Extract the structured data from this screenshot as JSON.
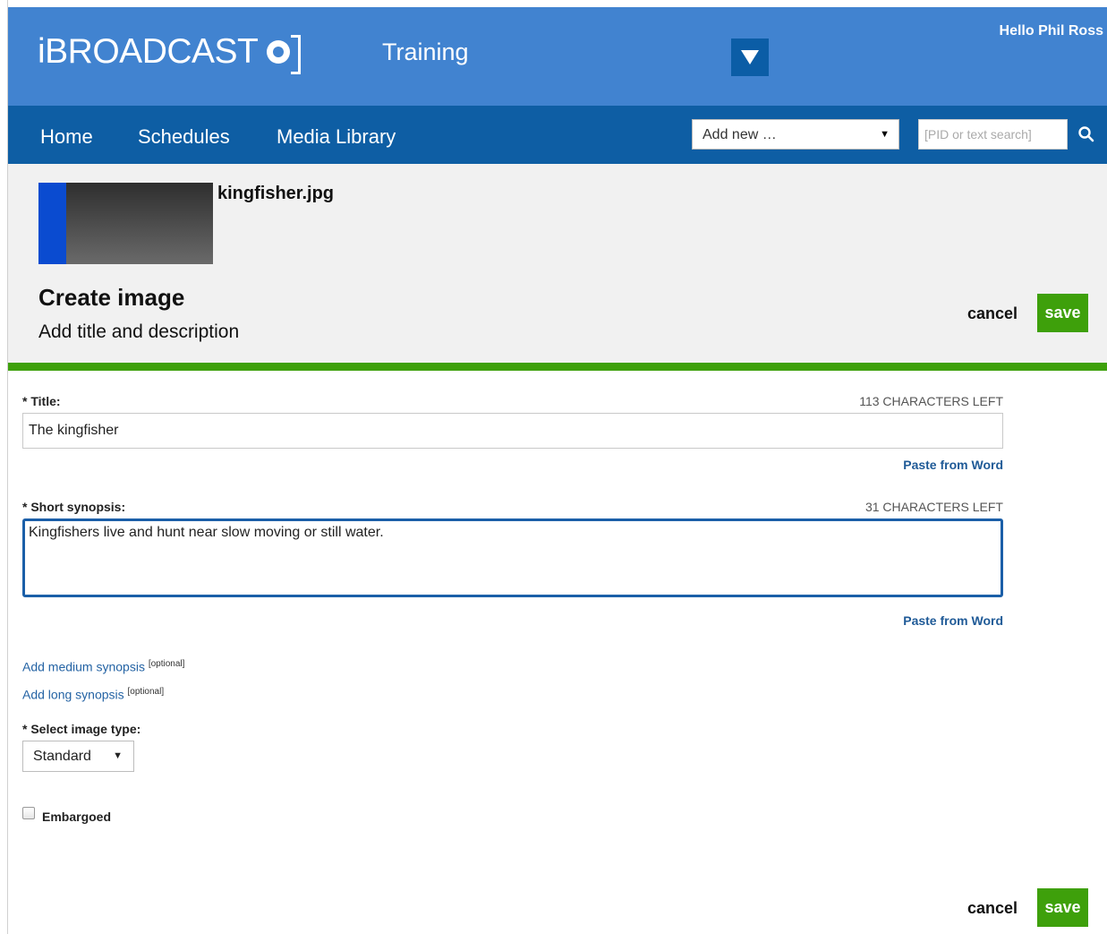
{
  "header": {
    "logo_text": "iBROADCAST",
    "environment": "Training",
    "greeting": "Hello Phil Ross"
  },
  "nav": {
    "items": [
      "Home",
      "Schedules",
      "Media Library"
    ],
    "add_new": "Add new …",
    "search_placeholder": "[PID or text search]"
  },
  "asset": {
    "filename": "kingfisher.jpg",
    "heading": "Create image",
    "subheading": "Add title and description"
  },
  "actions": {
    "cancel": "cancel",
    "save": "save"
  },
  "form": {
    "title": {
      "label": "* Title:",
      "counter": "113 CHARACTERS LEFT",
      "value": "The kingfisher",
      "paste": "Paste from Word"
    },
    "short_synopsis": {
      "label": "* Short synopsis:",
      "counter": "31 CHARACTERS LEFT",
      "value": "Kingfishers live and hunt near slow moving or still water.",
      "paste": "Paste from Word"
    },
    "medium_synopsis": {
      "link": "Add medium synopsis",
      "tag": "[optional]"
    },
    "long_synopsis": {
      "link": "Add long synopsis",
      "tag": "[optional]"
    },
    "image_type": {
      "label": "* Select image type:",
      "value": "Standard"
    },
    "embargoed": {
      "label": "Embargoed",
      "checked": false
    }
  },
  "colors": {
    "banner": "#4183d0",
    "nav": "#0e5ea4",
    "accent_green": "#3ea00b",
    "link": "#2463a4"
  }
}
